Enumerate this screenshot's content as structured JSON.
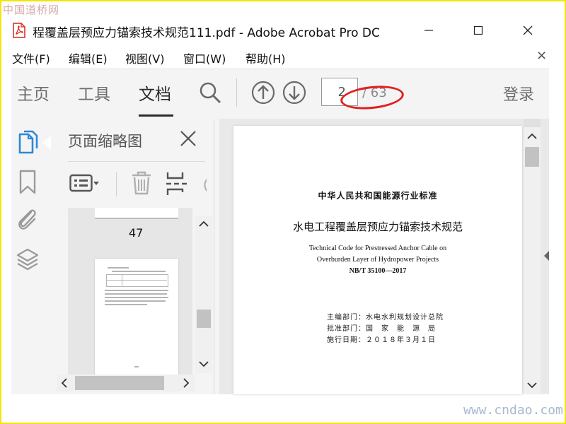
{
  "watermark_top": "中国道桥网",
  "watermark_bottom": "www.cndao.com",
  "window": {
    "title": "程覆盖层预应力锚索技术规范111.pdf - Adobe Acrobat Pro DC",
    "minimize": "—",
    "maximize": "☐",
    "close": "✕"
  },
  "menu": {
    "items": [
      "文件(F)",
      "编辑(E)",
      "视图(V)",
      "窗口(W)",
      "帮助(H)"
    ],
    "close": "×"
  },
  "toolbar": {
    "tabs": [
      "主页",
      "工具",
      "文档"
    ],
    "active_tab": "文档",
    "current_page": "2",
    "total_pages": "/ 63",
    "login": "登录"
  },
  "sidebar": {
    "panel_title": "页面缩略图",
    "thumbnail_page_number": "47"
  },
  "document": {
    "line1": "中华人民共和国能源行业标准",
    "line2": "水电工程覆盖层预应力锚索技术规范",
    "line3": "Technical Code for Prestressed Anchor Cable on",
    "line4": "Overburden Layer of Hydropower Projects",
    "line5": "NB/T 35100—2017",
    "meta1": "主编部门：水电水利规划设计总院",
    "meta2": "批准部门：国　家　能　源　局",
    "meta3": "施行日期：２０１８年３月１日"
  },
  "colors": {
    "accent_icons": "#2d88d6",
    "highlight_ellipse": "#e02020",
    "frame": "#f2e600",
    "pdf_icon": "#d9251d"
  }
}
